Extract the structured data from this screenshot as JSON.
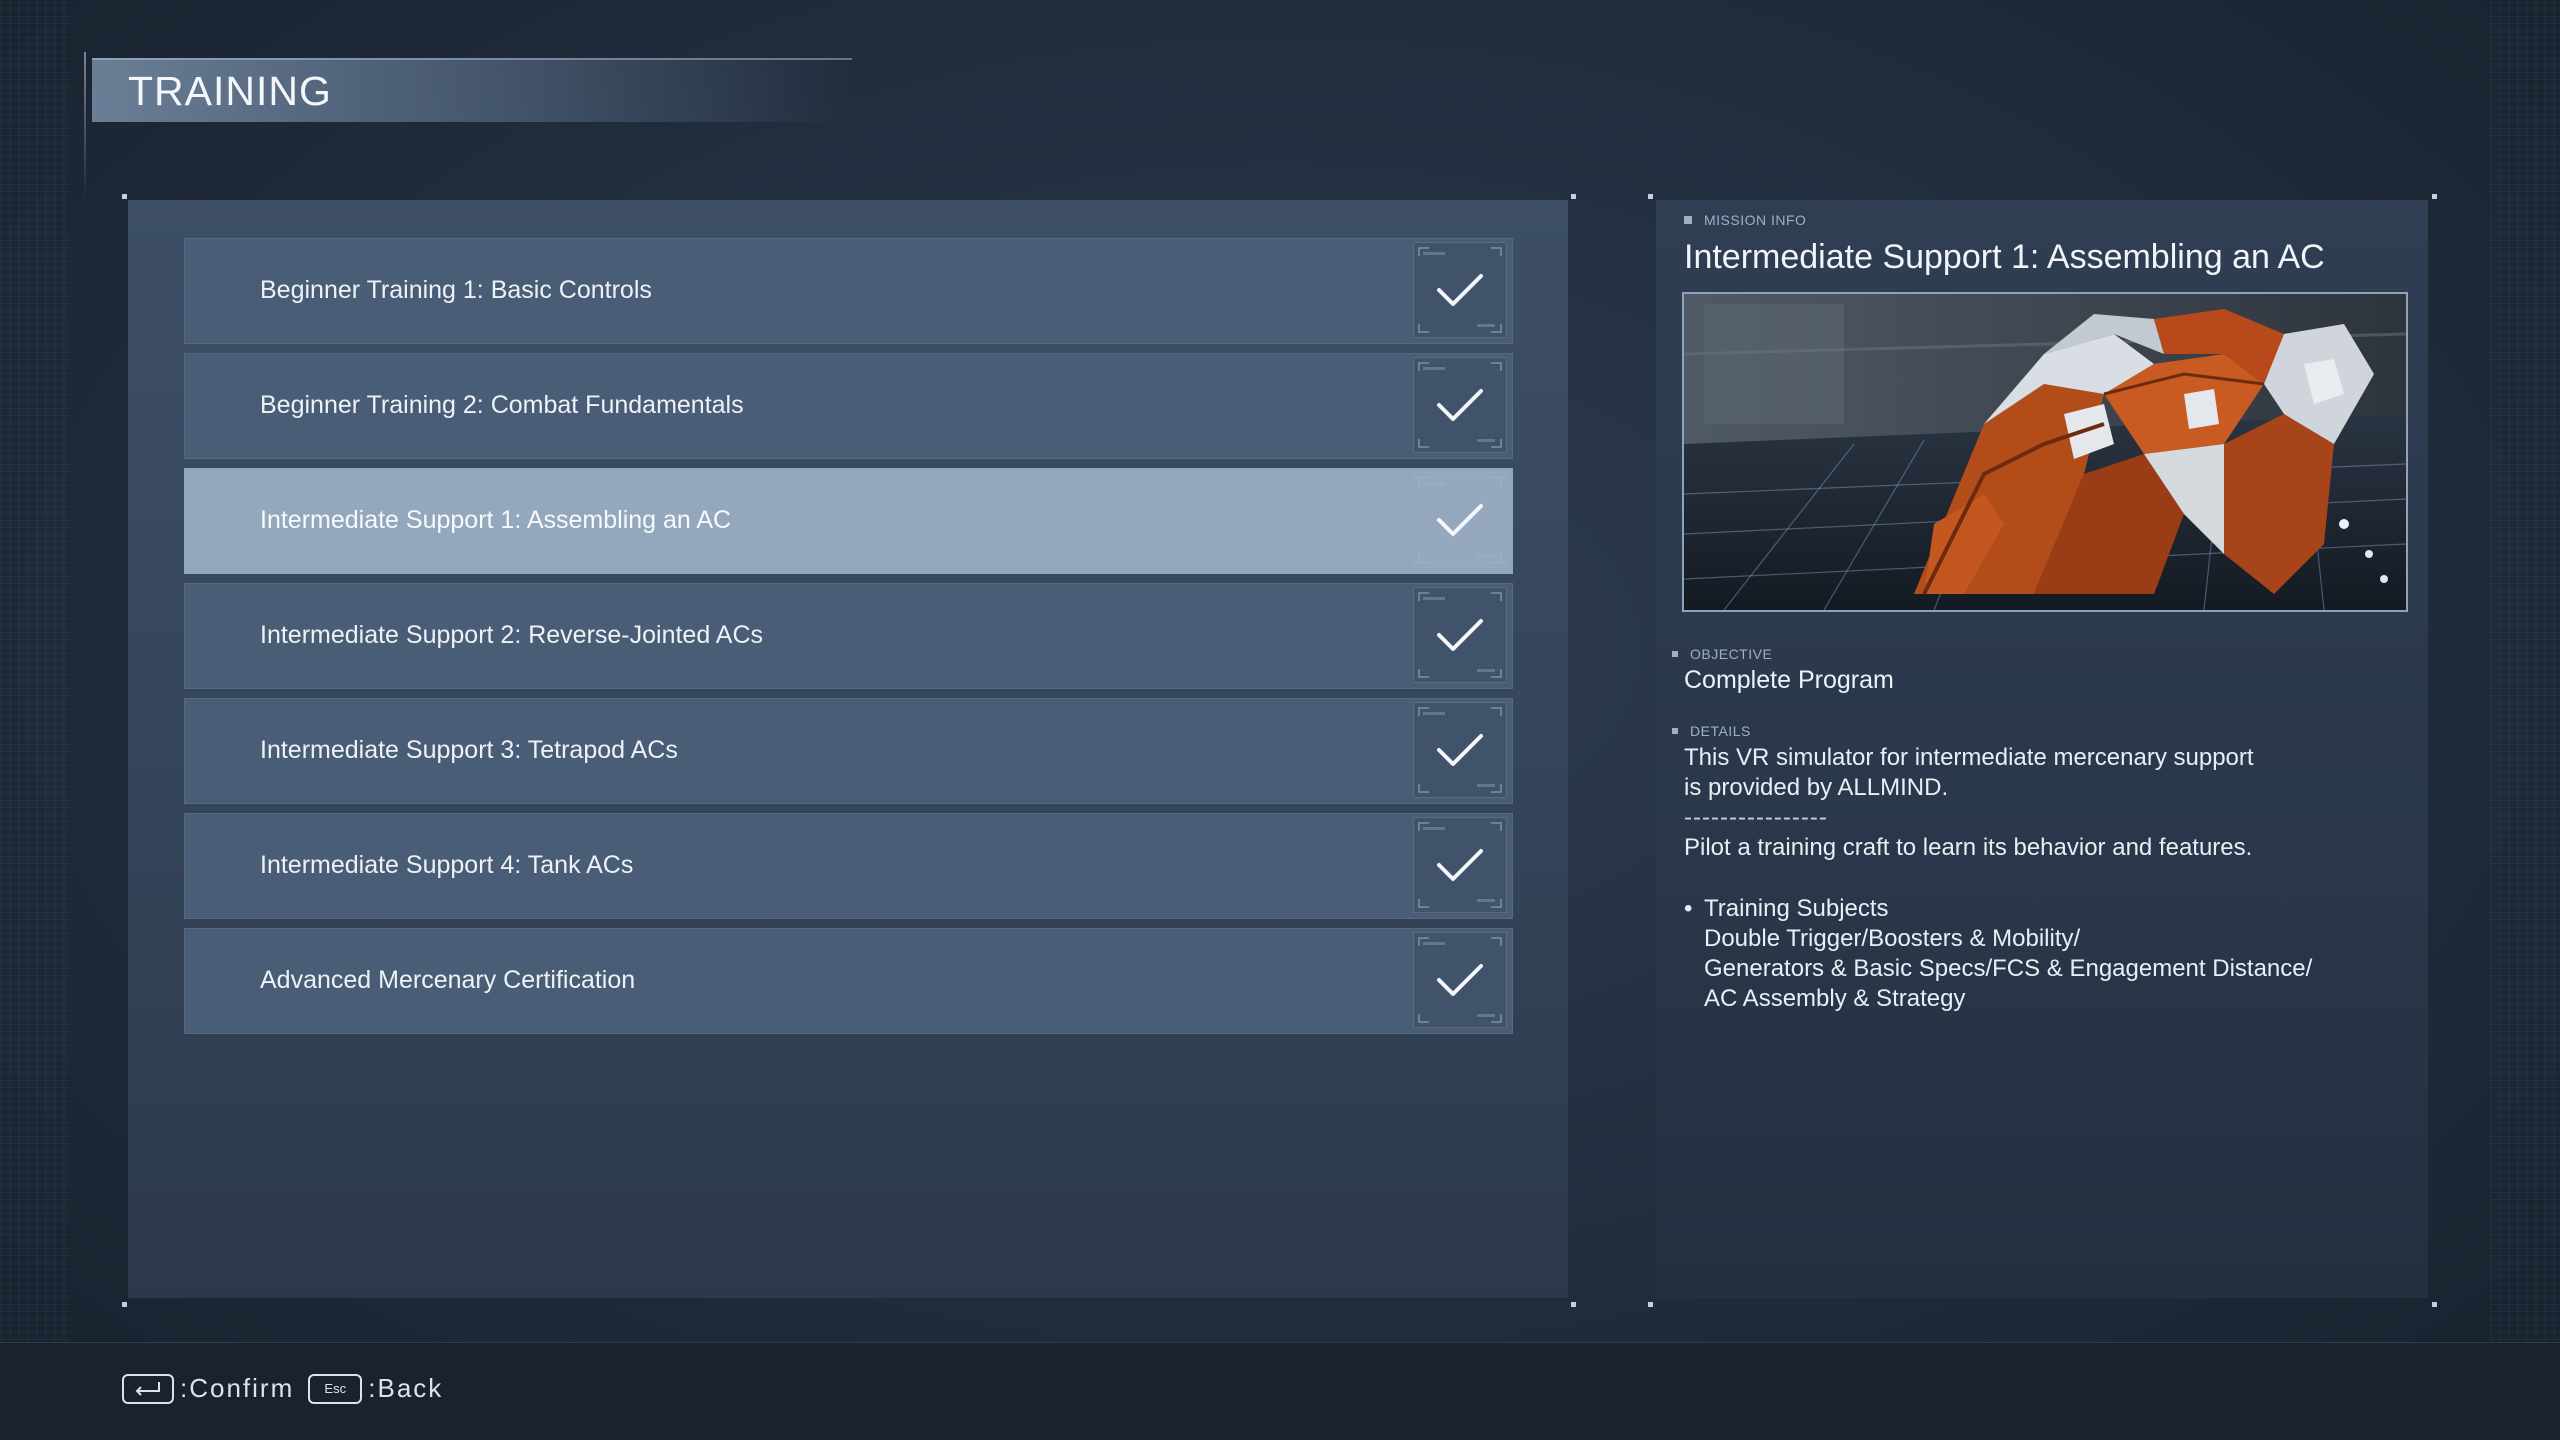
{
  "header": {
    "title": "TRAINING"
  },
  "missions": [
    {
      "label": "Beginner Training 1: Basic Controls",
      "completed": true,
      "selected": false
    },
    {
      "label": "Beginner Training 2: Combat Fundamentals",
      "completed": true,
      "selected": false
    },
    {
      "label": "Intermediate Support 1: Assembling an AC",
      "completed": true,
      "selected": true
    },
    {
      "label": "Intermediate Support 2: Reverse-Jointed ACs",
      "completed": true,
      "selected": false
    },
    {
      "label": "Intermediate Support 3: Tetrapod ACs",
      "completed": true,
      "selected": false
    },
    {
      "label": "Intermediate Support 4: Tank ACs",
      "completed": true,
      "selected": false
    },
    {
      "label": "Advanced Mercenary Certification",
      "completed": true,
      "selected": false
    }
  ],
  "info": {
    "section_label": "MISSION INFO",
    "title": "Intermediate Support 1: Assembling an AC",
    "objective_label": "OBJECTIVE",
    "objective": "Complete Program",
    "details_label": "DETAILS",
    "details_line1": "This VR simulator for intermediate mercenary support",
    "details_line2": "is provided by ALLMIND.",
    "separator": "----------------",
    "details_line3": "Pilot a training craft to learn its behavior and features.",
    "subjects_bullet": "•",
    "subjects_heading": "Training Subjects",
    "subjects_line1": "Double Trigger/Boosters & Mobility/",
    "subjects_line2": "Generators & Basic Specs/FCS & Engagement Distance/",
    "subjects_line3": "AC Assembly & Strategy"
  },
  "footer": {
    "confirm_label": ":Confirm",
    "esc_key": "Esc",
    "back_label": ":Back"
  },
  "colors": {
    "row": "#4a5d77",
    "row_selected": "#94a8bd",
    "accent_orange": "#c2561e"
  }
}
